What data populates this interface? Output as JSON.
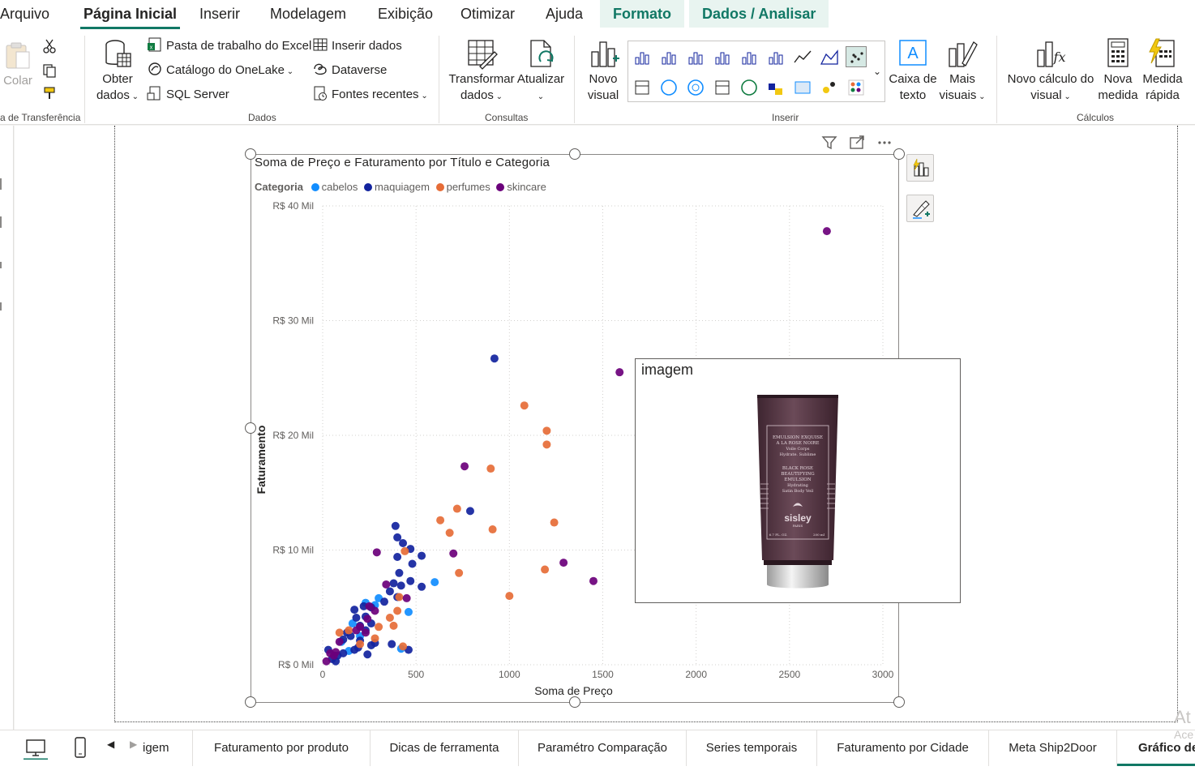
{
  "menu": {
    "tabs": [
      "Arquivo",
      "Página Inicial",
      "Inserir",
      "Modelagem",
      "Exibição",
      "Otimizar",
      "Ajuda"
    ],
    "context_tabs": [
      "Formato",
      "Dados / Analisar"
    ],
    "active_tab": "Página Inicial"
  },
  "ribbon": {
    "clipboard": {
      "paste": "Colar",
      "group": "a de Transferência"
    },
    "dados": {
      "obter": "Obter",
      "obter2": "dados",
      "excel": "Pasta de trabalho do Excel",
      "onelake": "Catálogo do OneLake",
      "sql": "SQL Server",
      "inserir": "Inserir dados",
      "dataverse": "Dataverse",
      "fontes": "Fontes recentes",
      "group": "Dados"
    },
    "consultas": {
      "transformar": "Transformar",
      "transformar2": "dados",
      "atualizar": "Atualizar",
      "group": "Consultas"
    },
    "inserir": {
      "novo_visual": "Novo",
      "novo_visual2": "visual",
      "caixa": "Caixa de",
      "caixa2": "texto",
      "mais": "Mais",
      "mais2": "visuais",
      "group": "Inserir"
    },
    "calculos": {
      "novo_calc": "Novo cálculo do",
      "novo_calc2": "visual",
      "nova_medida": "Nova",
      "nova_medida2": "medida",
      "medida_rapida": "Medida",
      "medida_rapida2": "rápida",
      "group": "Cálculos"
    }
  },
  "visual": {
    "title": "Soma de Preço e Faturamento por Título e Categoria",
    "legend_title": "Categoria"
  },
  "tooltip": {
    "title": "imagem",
    "product_lines": [
      "EMULSION EXQUISE",
      "A LA ROSE NOIRE",
      "Voile Corps",
      "Hydrate. Sublime",
      "BLACK ROSE",
      "BEAUTIFYING",
      "EMULSION",
      "Hydrating",
      "Satin Body Veil",
      "sisley",
      "PARIS",
      "6.7 FL. OZ.",
      "200 ml"
    ]
  },
  "colors": {
    "cabelos": "#118dff",
    "maquiagem": "#12239e",
    "perfumes": "#e66c37",
    "skincare": "#6b007b",
    "accent": "#117865"
  },
  "chart_data": {
    "type": "scatter",
    "title": "Soma de Preço e Faturamento por Título e Categoria",
    "xlabel": "Soma de Preço",
    "ylabel": "Faturamento",
    "xlim": [
      0,
      3000
    ],
    "ylim": [
      0,
      40000
    ],
    "x_ticks": [
      0,
      500,
      1000,
      1500,
      2000,
      2500,
      3000
    ],
    "x_tick_labels": [
      "0",
      "500",
      "1000",
      "1500",
      "2000",
      "2500",
      "3000"
    ],
    "y_ticks": [
      0,
      10000,
      20000,
      30000,
      40000
    ],
    "y_tick_labels": [
      "R$ 0 Mil",
      "R$ 10 Mil",
      "R$ 20 Mil",
      "R$ 30 Mil",
      "R$ 40 Mil"
    ],
    "grid": true,
    "legend": "top-left",
    "series": [
      {
        "name": "cabelos",
        "points": [
          [
            600,
            7200
          ],
          [
            460,
            4600
          ],
          [
            300,
            5800
          ],
          [
            160,
            3600
          ],
          [
            140,
            1200
          ],
          [
            230,
            5400
          ],
          [
            100,
            2000
          ],
          [
            280,
            5200
          ],
          [
            200,
            2500
          ],
          [
            420,
            1400
          ]
        ]
      },
      {
        "name": "maquiagem",
        "points": [
          [
            920,
            26700
          ],
          [
            790,
            13400
          ],
          [
            390,
            12100
          ],
          [
            400,
            11100
          ],
          [
            430,
            10600
          ],
          [
            470,
            10100
          ],
          [
            400,
            9400
          ],
          [
            530,
            9500
          ],
          [
            480,
            8800
          ],
          [
            410,
            8000
          ],
          [
            470,
            7300
          ],
          [
            380,
            7100
          ],
          [
            420,
            6900
          ],
          [
            530,
            6800
          ],
          [
            360,
            6400
          ],
          [
            400,
            5900
          ],
          [
            330,
            5500
          ],
          [
            220,
            5100
          ],
          [
            260,
            5000
          ],
          [
            170,
            4800
          ],
          [
            230,
            4200
          ],
          [
            260,
            3600
          ],
          [
            200,
            3400
          ],
          [
            230,
            3000
          ],
          [
            150,
            2500
          ],
          [
            200,
            2100
          ],
          [
            260,
            1700
          ],
          [
            190,
            1500
          ],
          [
            170,
            1300
          ],
          [
            110,
            1000
          ],
          [
            80,
            800
          ],
          [
            50,
            500
          ],
          [
            30,
            1300
          ],
          [
            70,
            300
          ],
          [
            280,
            1900
          ],
          [
            240,
            900
          ],
          [
            460,
            1300
          ],
          [
            370,
            1800
          ],
          [
            130,
            2800
          ],
          [
            180,
            4100
          ],
          [
            110,
            2200
          ]
        ]
      },
      {
        "name": "perfumes",
        "points": [
          [
            1080,
            22600
          ],
          [
            1200,
            20400
          ],
          [
            1200,
            19200
          ],
          [
            900,
            17100
          ],
          [
            720,
            13600
          ],
          [
            630,
            12600
          ],
          [
            1240,
            12400
          ],
          [
            910,
            11800
          ],
          [
            680,
            11500
          ],
          [
            440,
            9900
          ],
          [
            730,
            8000
          ],
          [
            1190,
            8300
          ],
          [
            1000,
            6000
          ],
          [
            410,
            5900
          ],
          [
            380,
            3400
          ],
          [
            400,
            4700
          ],
          [
            360,
            4100
          ],
          [
            300,
            3300
          ],
          [
            140,
            3000
          ],
          [
            90,
            2800
          ],
          [
            280,
            2300
          ],
          [
            430,
            1600
          ],
          [
            200,
            1800
          ]
        ]
      },
      {
        "name": "skincare",
        "points": [
          [
            2700,
            37800
          ],
          [
            1590,
            25500
          ],
          [
            760,
            17300
          ],
          [
            700,
            9700
          ],
          [
            290,
            9800
          ],
          [
            1290,
            8900
          ],
          [
            1450,
            7300
          ],
          [
            340,
            7000
          ],
          [
            450,
            5800
          ],
          [
            240,
            4000
          ],
          [
            200,
            3300
          ],
          [
            230,
            2800
          ],
          [
            70,
            1100
          ],
          [
            60,
            800
          ],
          [
            20,
            300
          ],
          [
            250,
            5100
          ],
          [
            280,
            4700
          ],
          [
            180,
            3000
          ],
          [
            90,
            2000
          ],
          [
            40,
            1000
          ]
        ]
      }
    ]
  },
  "page_tabs": {
    "tabs": [
      "igem",
      "Faturamento por produto",
      "Dicas de ferramenta",
      "Paramétro Comparação",
      "Series temporais",
      "Faturamento por Cidade",
      "Meta Ship2Door",
      "Gráfico de"
    ],
    "active": "Gráfico de"
  },
  "watermark": {
    "line1": "At",
    "line2": "Ace"
  }
}
